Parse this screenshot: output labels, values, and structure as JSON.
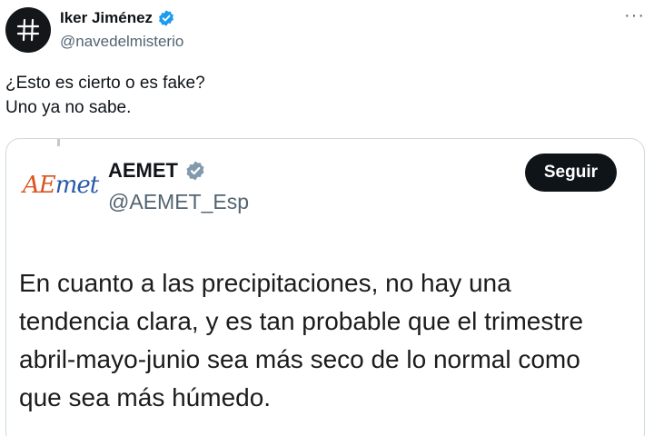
{
  "tweet": {
    "author": {
      "name": "Iker Jiménez",
      "handle": "@navedelmisterio",
      "verified": true,
      "avatar_icon": "hashtag-icon"
    },
    "more_icon": "more-horizontal-icon",
    "text_lines": [
      "¿Esto es cierto o es fake?",
      "Uno ya no sabe."
    ]
  },
  "quote": {
    "logo_text": {
      "part1": "AE",
      "part2": "met"
    },
    "author": {
      "name": "AEMET",
      "handle": "@AEMET_Esp",
      "verified": true,
      "badge": "gray-verified-icon"
    },
    "follow_label": "Seguir",
    "text": "En cuanto a las precipitaciones, no hay una tendencia clara, y es tan probable que el trimestre abril-mayo-junio sea más seco de lo normal como que sea más húmedo."
  },
  "colors": {
    "verified_blue": "#1d9bf0",
    "verified_gray": "#829aab",
    "logo_orange": "#d9541e",
    "logo_blue": "#2a5aa8",
    "text": "#0f1419",
    "secondary": "#536471"
  }
}
